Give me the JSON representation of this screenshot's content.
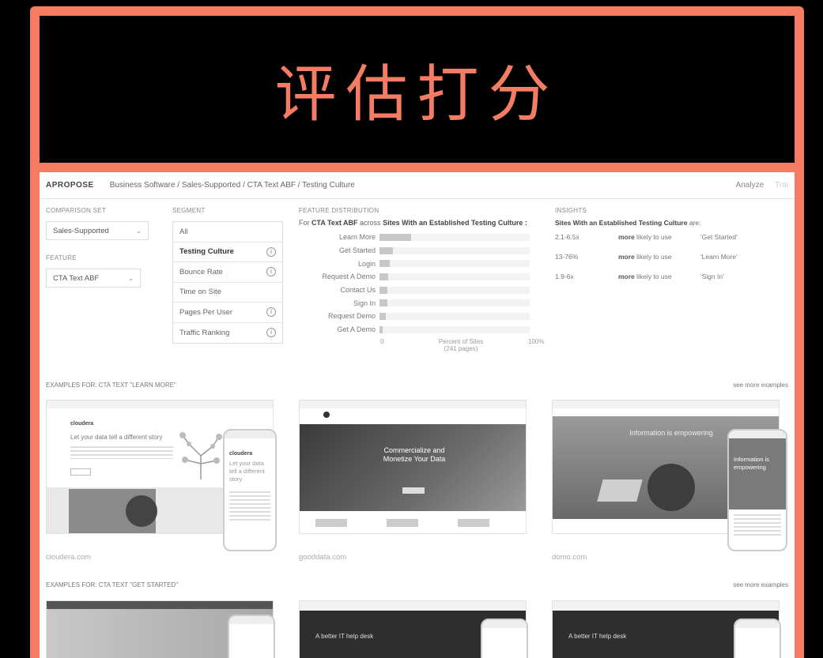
{
  "banner": {
    "title": "评估打分"
  },
  "topbar": {
    "logo": "APROPOSE",
    "breadcrumb": "Business Software / Sales-Supported / CTA Text ABF / Testing Culture",
    "nav": [
      "Analyze",
      "Trai"
    ]
  },
  "comparison_set": {
    "label": "COMPARISON SET",
    "value": "Sales-Supported"
  },
  "feature": {
    "label": "FEATURE",
    "value": "CTA Text ABF"
  },
  "segment": {
    "label": "SEGMENT",
    "items": [
      {
        "label": "All",
        "info": false,
        "active": false
      },
      {
        "label": "Testing Culture",
        "info": true,
        "active": true
      },
      {
        "label": "Bounce Rate",
        "info": true,
        "active": false
      },
      {
        "label": "Time on Site",
        "info": false,
        "active": false
      },
      {
        "label": "Pages Per User",
        "info": true,
        "active": false
      },
      {
        "label": "Traffic Ranking",
        "info": true,
        "active": false
      }
    ]
  },
  "distribution": {
    "label": "FEATURE DISTRIBUTION",
    "intro_for": "For",
    "intro_feature": "CTA Text ABF",
    "intro_across": "across",
    "intro_segment": "Sites With an Established Testing Culture :",
    "axis_min": "0",
    "axis_max": "100%",
    "axis_title": "Percent of Sites",
    "axis_subtitle": "(241 pages)"
  },
  "chart_data": {
    "type": "bar",
    "categories": [
      "Learn More",
      "Get Started",
      "Login",
      "Request A Demo",
      "Contact Us",
      "Sign In",
      "Request Demo",
      "Get A Demo"
    ],
    "values": [
      21,
      9,
      7,
      6,
      5,
      5,
      4,
      2
    ],
    "xlim": [
      0,
      100
    ]
  },
  "insights": {
    "label": "INSIGHTS",
    "header_segment": "Sites With an Established Testing Culture",
    "header_suffix": "are:",
    "rows": [
      {
        "value": "2.1-6.5x",
        "more": "more",
        "rest": "likely to use",
        "cta": "'Get Started'"
      },
      {
        "value": "13-76%",
        "more": "more",
        "rest": "likely to use",
        "cta": "'Learn More'"
      },
      {
        "value": "1.9-6x",
        "more": "more",
        "rest": "likely to use",
        "cta": "'Sign In'"
      }
    ]
  },
  "examples_learn_more": {
    "title": "EXAMPLES FOR: CTA TEXT \"LEARN MORE\"",
    "more": "see more examples",
    "sites": [
      "cloudera.com",
      "gooddata.com",
      "domo.com"
    ]
  },
  "examples_get_started": {
    "title": "EXAMPLES FOR: CTA TEXT \"GET STARTED\"",
    "more": "see more examples"
  },
  "thumbs": {
    "cloudera_heading": "Let your data tell a different story",
    "cloudera_logo": "cloudera",
    "gooddata_heading": "Commercialize and Monetize Your Data",
    "domo_heading": "Information is empowering",
    "getstarted_heading": "A better IT help desk"
  }
}
